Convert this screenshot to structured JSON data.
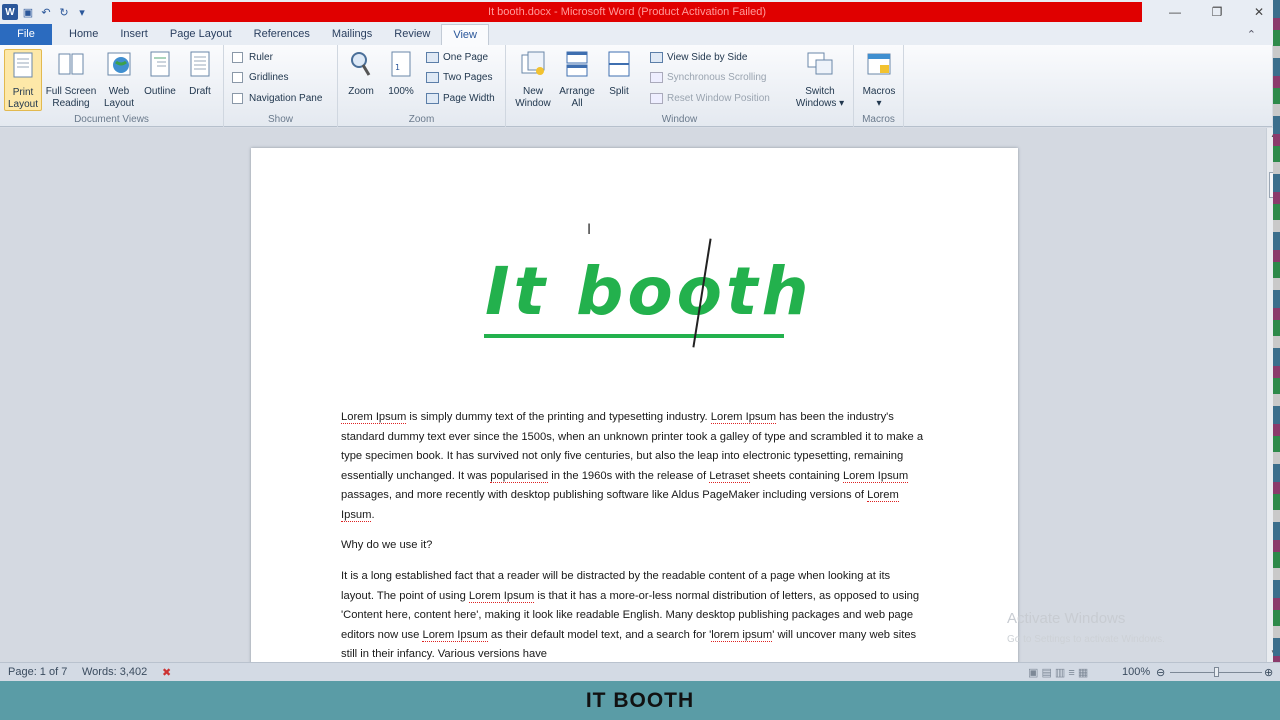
{
  "window": {
    "title": "It booth.docx - Microsoft Word (Product Activation Failed)",
    "controls": [
      "minimize",
      "restore",
      "close"
    ]
  },
  "qat": {
    "icons": [
      "word-logo-icon",
      "save-icon",
      "undo-icon",
      "redo-icon",
      "customize-qat-icon"
    ],
    "word_logo": "W"
  },
  "tabs": [
    "File",
    "Home",
    "Insert",
    "Page Layout",
    "References",
    "Mailings",
    "Review",
    "View"
  ],
  "active_tab": "View",
  "ribbon": {
    "document_views": {
      "label": "Document Views",
      "buttons": [
        "Print Layout",
        "Full Screen Reading",
        "Web Layout",
        "Outline",
        "Draft"
      ],
      "print_layout": [
        "Print",
        "Layout"
      ],
      "full_screen": [
        "Full Screen",
        "Reading"
      ],
      "web_layout": [
        "Web",
        "Layout"
      ],
      "outline": "Outline",
      "draft": "Draft"
    },
    "show": {
      "label": "Show",
      "ruler": "Ruler",
      "gridlines": "Gridlines",
      "navigation_pane": "Navigation Pane"
    },
    "zoom": {
      "label": "Zoom",
      "zoom": "Zoom",
      "hundred": "100%",
      "one_page": "One Page",
      "two_pages": "Two Pages",
      "page_width": "Page Width"
    },
    "window": {
      "label": "Window",
      "new_window": [
        "New",
        "Window"
      ],
      "arrange_all": [
        "Arrange",
        "All"
      ],
      "split": "Split",
      "view_side_by_side": "View Side by Side",
      "synchronous_scrolling": "Synchronous Scrolling",
      "reset_window_position": "Reset Window Position",
      "switch_windows": [
        "Switch",
        "Windows ▾"
      ]
    },
    "macros": {
      "label": "Macros",
      "macros": "Macros",
      "arrow": "▾"
    }
  },
  "document": {
    "title": "It booth",
    "para1_parts": [
      {
        "t": "Lorem Ipsum",
        "sq": true
      },
      {
        "t": " is simply dummy text of the printing and typesetting industry. ",
        "sq": false
      },
      {
        "t": "Lorem Ipsum",
        "sq": true
      },
      {
        "t": " has been the industry's standard dummy text ever since the 1500s,  when an unknown printer took a galley of type and scrambled it to make a type specimen book. It has survived not only five centuries, but also the leap into electronic typesetting, remaining essentially unchanged. It was ",
        "sq": false
      },
      {
        "t": "popularised",
        "sq": true
      },
      {
        "t": " in the 1960s  with the release of ",
        "sq": false
      },
      {
        "t": "Letraset",
        "sq": true
      },
      {
        "t": " sheets containing ",
        "sq": false
      },
      {
        "t": "Lorem Ipsum",
        "sq": true
      },
      {
        "t": " passages, and more recently with desktop publishing software like Aldus PageMaker including versions of ",
        "sq": false
      },
      {
        "t": "Lorem Ipsum",
        "sq": true
      },
      {
        "t": ".",
        "sq": false
      }
    ],
    "heading2": "Why do we use it?",
    "para2_parts": [
      {
        "t": "It is a long established fact that a reader will be distracted by the readable content of a page when looking at its layout. The point of using ",
        "sq": false
      },
      {
        "t": "Lorem Ipsum",
        "sq": true
      },
      {
        "t": " is that it has a more-or-less normal distribution of letters, as opposed to using 'Content here, content here', making it look like readable English. Many desktop publishing packages and web page editors now use ",
        "sq": false
      },
      {
        "t": "Lorem Ipsum",
        "sq": true
      },
      {
        "t": " as their default model text, and a search for '",
        "sq": false
      },
      {
        "t": "lorem ipsum",
        "sq": true
      },
      {
        "t": "' will uncover many web sites still in their infancy. Various versions have",
        "sq": false
      }
    ]
  },
  "watermark": {
    "line1": "Activate Windows",
    "line2": "Go to Settings to activate Windows."
  },
  "status": {
    "page": "Page: 1 of 7",
    "words": "Words: 3,402",
    "zoom": "100%"
  },
  "caption": "IT BOOTH",
  "colors": {
    "title_green": "#23b14d",
    "titlebar_red": "#e00000",
    "caption_band": "#5a9ca6",
    "file_tab": "#2b6bbf"
  }
}
